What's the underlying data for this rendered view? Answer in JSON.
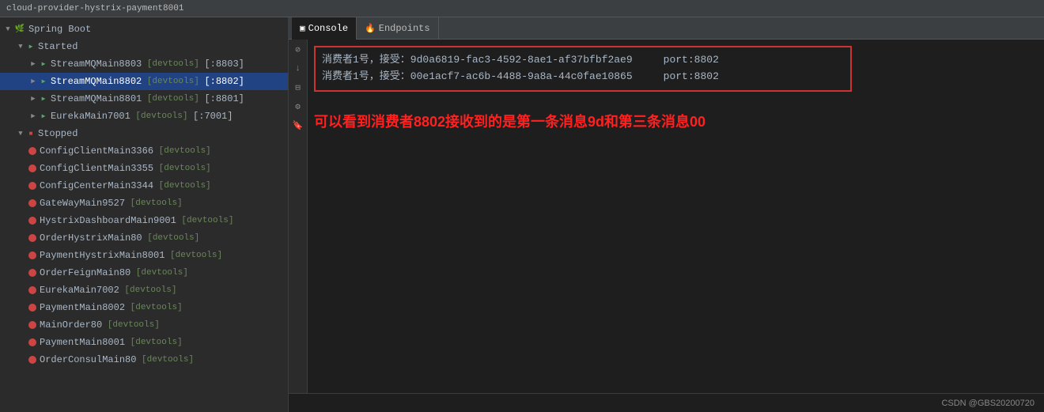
{
  "titleBar": {
    "text": "cloud-provider-hystrix-payment8001"
  },
  "sidebar": {
    "springBoot": "Spring Boot",
    "sections": [
      {
        "id": "started",
        "label": "Started",
        "expanded": true,
        "items": [
          {
            "id": "stream8803",
            "label": "StreamMQMain8803",
            "devtools": "[devtools]",
            "port": "[:8803]",
            "selected": false
          },
          {
            "id": "stream8802",
            "label": "StreamMQMain8802",
            "devtools": "[devtools]",
            "port": "[:8802]",
            "selected": true
          },
          {
            "id": "stream8801",
            "label": "StreamMQMain8801",
            "devtools": "[devtools]",
            "port": "[:8801]",
            "selected": false
          },
          {
            "id": "eureka7001",
            "label": "EurekaMain7001",
            "devtools": "[devtools]",
            "port": "[:7001]",
            "selected": false
          }
        ]
      },
      {
        "id": "stopped",
        "label": "Stopped",
        "expanded": true,
        "items": [
          {
            "id": "config3366",
            "label": "ConfigClientMain3366",
            "devtools": "[devtools]"
          },
          {
            "id": "config3355",
            "label": "ConfigClientMain3355",
            "devtools": "[devtools]"
          },
          {
            "id": "configcenter3344",
            "label": "ConfigCenterMain3344",
            "devtools": "[devtools]"
          },
          {
            "id": "gateway9527",
            "label": "GateWayMain9527",
            "devtools": "[devtools]"
          },
          {
            "id": "hystrixdashboard9001",
            "label": "HystrixDashboardMain9001",
            "devtools": "[devtools]"
          },
          {
            "id": "orderhystrix80",
            "label": "OrderHystrixMain80",
            "devtools": "[devtools]"
          },
          {
            "id": "paymenthystrix8001",
            "label": "PaymentHystrixMain8001",
            "devtools": "[devtools]"
          },
          {
            "id": "orderfeign80",
            "label": "OrderFeignMain80",
            "devtools": "[devtools]"
          },
          {
            "id": "eureka7002",
            "label": "EurekaMain7002",
            "devtools": "[devtools]"
          },
          {
            "id": "payment8002",
            "label": "PaymentMain8002",
            "devtools": "[devtools]"
          },
          {
            "id": "mainorder80",
            "label": "MainOrder80",
            "devtools": "[devtools]"
          },
          {
            "id": "payment8001",
            "label": "PaymentMain8001",
            "devtools": "[devtools]"
          },
          {
            "id": "orderconsul80",
            "label": "OrderConsulMain80",
            "devtools": "[devtools]"
          }
        ]
      }
    ]
  },
  "consoleTabs": [
    {
      "id": "console",
      "label": "Console",
      "icon": "▣",
      "active": true
    },
    {
      "id": "endpoints",
      "label": "Endpoints",
      "icon": "🔥",
      "active": false
    }
  ],
  "console": {
    "messages": [
      {
        "text": "消费者1号，接受：9d0a6819-fac3-4592-8ae1-af37bfbf2ae9     port:8802"
      },
      {
        "text": "消费者1号，接受：00e1acf7-ac6b-4488-9a8a-44c0fae10865     port:8802"
      }
    ],
    "annotation": "可以看到消费者8802接收到的是第一条消息9d和第三条消息00"
  },
  "footer": {
    "credit": "CSDN @GBS20200720"
  },
  "colors": {
    "selectedBg": "#214283",
    "stoppedDot": "#cc4444",
    "startedDot": "#59a869",
    "borderRed": "#cc3333",
    "annotationRed": "#ff2020"
  }
}
